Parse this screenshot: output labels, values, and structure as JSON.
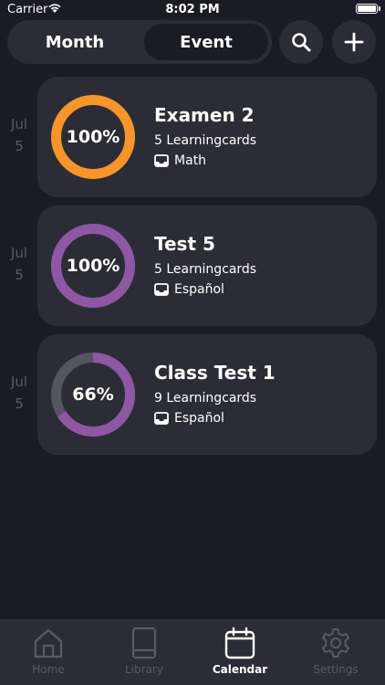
{
  "status_bar": {
    "carrier": "Carrier",
    "time": "8:02 PM"
  },
  "header": {
    "segments": [
      "Month",
      "Event"
    ],
    "selected_segment": "Event",
    "search_icon": "search-icon",
    "add_icon": "plus-icon"
  },
  "events": [
    {
      "date_month": "Jul",
      "date_day": "5",
      "progress_label": "100%",
      "progress": 1.0,
      "ring_color": "#f5952a",
      "title": "Examen 2",
      "count": "5 Learningcards",
      "subject": "Math"
    },
    {
      "date_month": "Jul",
      "date_day": "5",
      "progress_label": "100%",
      "progress": 1.0,
      "ring_color": "#8e57a4",
      "title": "Test 5",
      "count": "5 Learningcards",
      "subject": "Español"
    },
    {
      "date_month": "Jul",
      "date_day": "5",
      "progress_label": "66%",
      "progress": 0.66,
      "ring_color": "#8e57a4",
      "title": "Class Test 1",
      "count": "9 Learningcards",
      "subject": "Español"
    }
  ],
  "tabbar": {
    "tabs": [
      {
        "label": "Home",
        "icon": "home-icon"
      },
      {
        "label": "Library",
        "icon": "book-icon"
      },
      {
        "label": "Calendar",
        "icon": "calendar-icon"
      },
      {
        "label": "Settings",
        "icon": "gear-icon"
      }
    ],
    "active": "Calendar"
  },
  "colors": {
    "background": "#1b1b26",
    "card": "#2c2c36",
    "muted": "#5a5a66",
    "ring_track": "#55555f"
  }
}
